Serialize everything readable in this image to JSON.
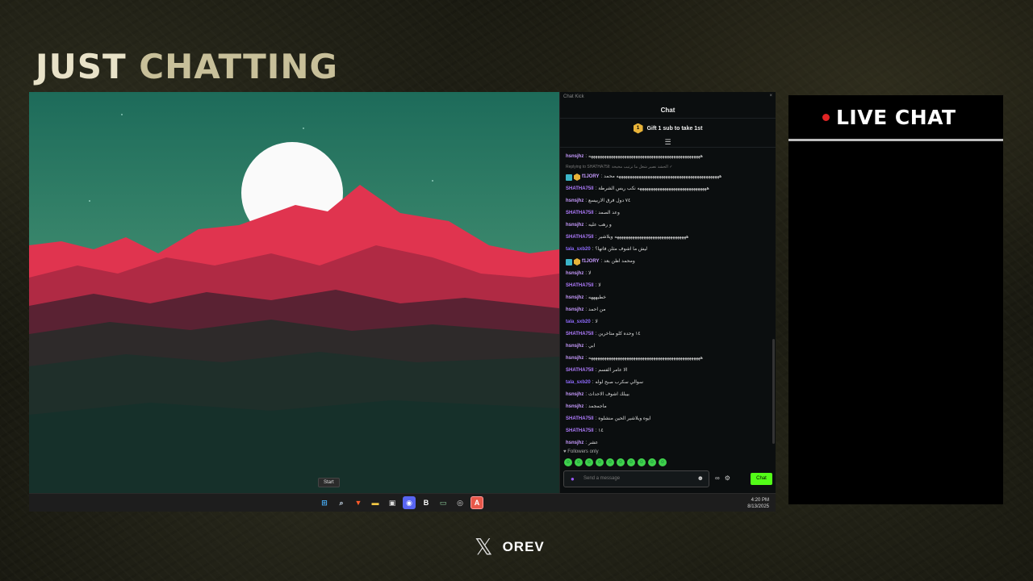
{
  "title": {
    "word1": "JUST",
    "word2": "CHATTING"
  },
  "desktop": {
    "tooltip": "Start",
    "taskbar": {
      "time": "4:20 PM",
      "date": "8/13/2025",
      "apps": [
        "windows-start-icon",
        "search-icon",
        "brave-browser-icon",
        "file-explorer-icon",
        "store-icon",
        "discord-icon",
        "bold-app-icon",
        "terminal-icon",
        "obs-icon",
        "kick-app-icon"
      ]
    }
  },
  "chat_window": {
    "app_name": "Chat Kick",
    "close": "×",
    "header": "Chat",
    "gift": {
      "badge": "1",
      "text": "Gift 1 sub to take 1st"
    },
    "reply_text": "Replying to SHATHA75ll: الحشد نصير شغل ما ترتيب مخيخة ✓",
    "messages": [
      {
        "user": "hsnsjhz",
        "color": "#c79bff",
        "text": "ههههههههههههههههههههههههههههههههههههههههههههههههههه"
      },
      {
        "user": "f1JORY",
        "color": "#c79bff",
        "text": "ههههههههههههههههههههههههههههههههههههههههههههههه محمد",
        "badges": true
      },
      {
        "user": "SHATHA75ll",
        "color": "#b07cff",
        "text": "هههههههههههههههههههههههههههههههه نكب ريس الشرطة"
      },
      {
        "user": "hsnsjhz",
        "color": "#c79bff",
        "text": "٧٤ دول فرق الاربيسع"
      },
      {
        "user": "SHATHA75ll",
        "color": "#b07cff",
        "text": "وعد الصمد"
      },
      {
        "user": "hsnsjhz",
        "color": "#c79bff",
        "text": "و رهب عليه"
      },
      {
        "user": "SHATHA75ll",
        "color": "#b07cff",
        "text": "ههههههههههههههههههههههههههههههههه ويلاشير"
      },
      {
        "user": "tala_sxb20",
        "color": "#8f6bff",
        "text": "ليش ما اشوف مثلن فاتها؟"
      },
      {
        "user": "f1JORY",
        "color": "#c79bff",
        "text": "ومحمد اظن بعد",
        "badges": true
      },
      {
        "user": "hsnsjhz",
        "color": "#c79bff",
        "text": "لا"
      },
      {
        "user": "SHATHA75ll",
        "color": "#b07cff",
        "text": "لا"
      },
      {
        "user": "hsnsjhz",
        "color": "#c79bff",
        "text": "خطيهههه"
      },
      {
        "user": "hsnsjhz",
        "color": "#c79bff",
        "text": "من احمد"
      },
      {
        "user": "tala_sxb20",
        "color": "#8f6bff",
        "text": "لا"
      },
      {
        "user": "SHATHA75ll",
        "color": "#b07cff",
        "text": "١٤ وحده كلو متاخرين"
      },
      {
        "user": "hsnsjhz",
        "color": "#c79bff",
        "text": "ابي"
      },
      {
        "user": "hsnsjhz",
        "color": "#c79bff",
        "text": "ههههههههههههههههههههههههههههههههههههههههههههههههههه"
      },
      {
        "user": "SHATHA75ll",
        "color": "#b07cff",
        "text": "الا عامر الفسم"
      },
      {
        "user": "tala_sxb20",
        "color": "#8f6bff",
        "text": "سوالي سكرب صبح لوله"
      },
      {
        "user": "hsnsjhz",
        "color": "#c79bff",
        "text": "بيبلك اشوف الاحداث"
      },
      {
        "user": "hsnsjhz",
        "color": "#c79bff",
        "text": "ماجمجمد"
      },
      {
        "user": "SHATHA75ll",
        "color": "#b07cff",
        "text": "ايوه ويلاشير الحين منشلوه"
      },
      {
        "user": "SHATHA75ll",
        "color": "#b07cff",
        "text": "١٤"
      },
      {
        "user": "hsnsjhz",
        "color": "#c79bff",
        "text": "عشر"
      }
    ],
    "followers_only": "Followers only",
    "input_placeholder": "Send a message",
    "send_label": "Chat"
  },
  "live_chat": {
    "label": "LIVE CHAT"
  },
  "footer": {
    "handle": "OREV"
  }
}
